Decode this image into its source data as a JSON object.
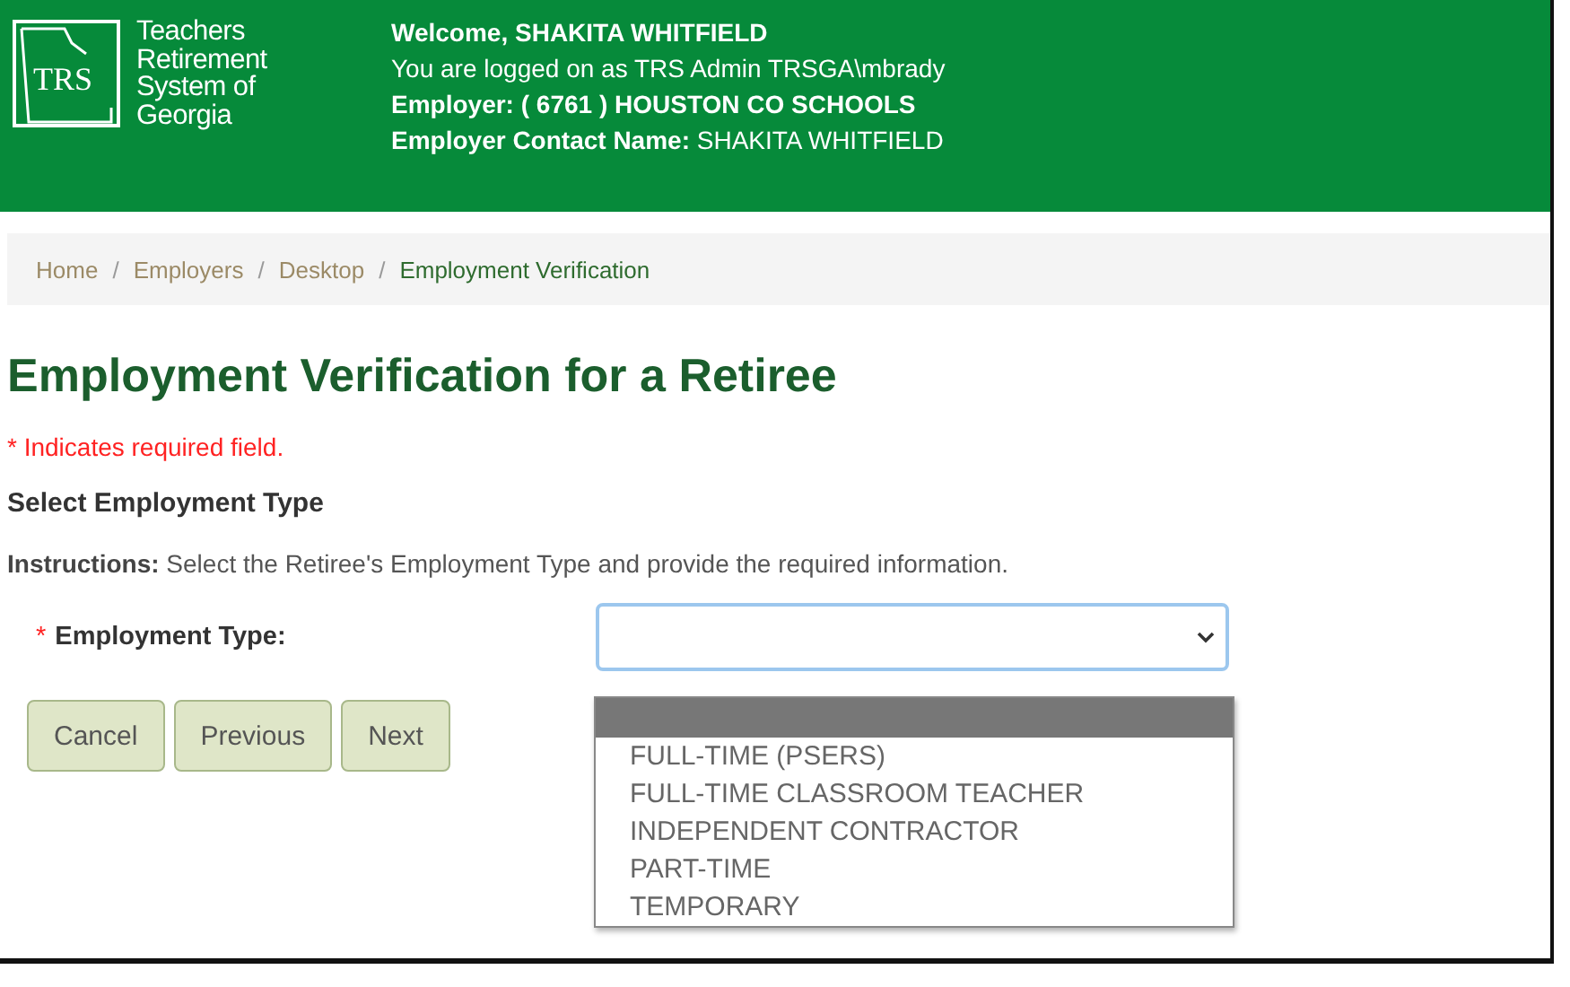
{
  "header": {
    "org_name": "Teachers Retirement System of Georgia",
    "logo_text": "TRS",
    "welcome_label": "Welcome,",
    "welcome_name": "SHAKITA WHITFIELD",
    "logged_on": "You are logged on as TRS Admin TRSGA\\mbrady",
    "employer": "Employer: ( 6761 ) HOUSTON CO SCHOOLS",
    "contact_label": "Employer Contact Name:",
    "contact_name": "SHAKITA WHITFIELD"
  },
  "breadcrumb": [
    {
      "label": "Home",
      "current": false
    },
    {
      "label": "Employers",
      "current": false
    },
    {
      "label": "Desktop",
      "current": false
    },
    {
      "label": "Employment Verification",
      "current": true
    }
  ],
  "breadcrumb_separator": "/",
  "title": "Employment Verification for a Retiree",
  "required_note": "* Indicates required field.",
  "section_heading": "Select Employment Type",
  "instructions": "**Instructions:** Select the Retiree's Employment Type and provide the required information.",
  "employment_type": {
    "required_mark": "*",
    "label": "Employment Type:",
    "expanded": true,
    "blank_option_highlighted": true,
    "options": [
      {
        "label": "FULL-TIME (PSERS)",
        "selected": false
      },
      {
        "label": "FULL-TIME CLASSROOM TEACHER",
        "selected": false
      },
      {
        "label": "INDEPENDENT CONTRACTOR",
        "selected": false
      },
      {
        "label": "PART-TIME",
        "selected": false
      },
      {
        "label": "TEMPORARY",
        "selected": false
      }
    ]
  },
  "buttons": [
    "Cancel",
    "Previous",
    "Next"
  ]
}
